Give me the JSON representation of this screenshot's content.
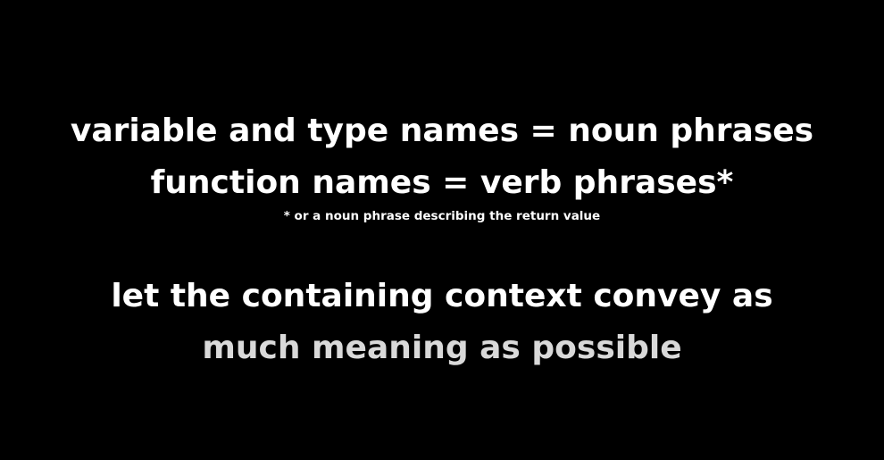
{
  "slide": {
    "block1": {
      "line1": "variable and type names = noun phrases",
      "line2": "function names = verb phrases*",
      "footnote": "* or a noun phrase describing the return value"
    },
    "block2": {
      "line1": "let the containing context convey as",
      "line2": "much meaning as possible"
    }
  },
  "colors": {
    "background": "#000000",
    "text": "#ffffff",
    "text_faded": "#d9d9d9"
  }
}
